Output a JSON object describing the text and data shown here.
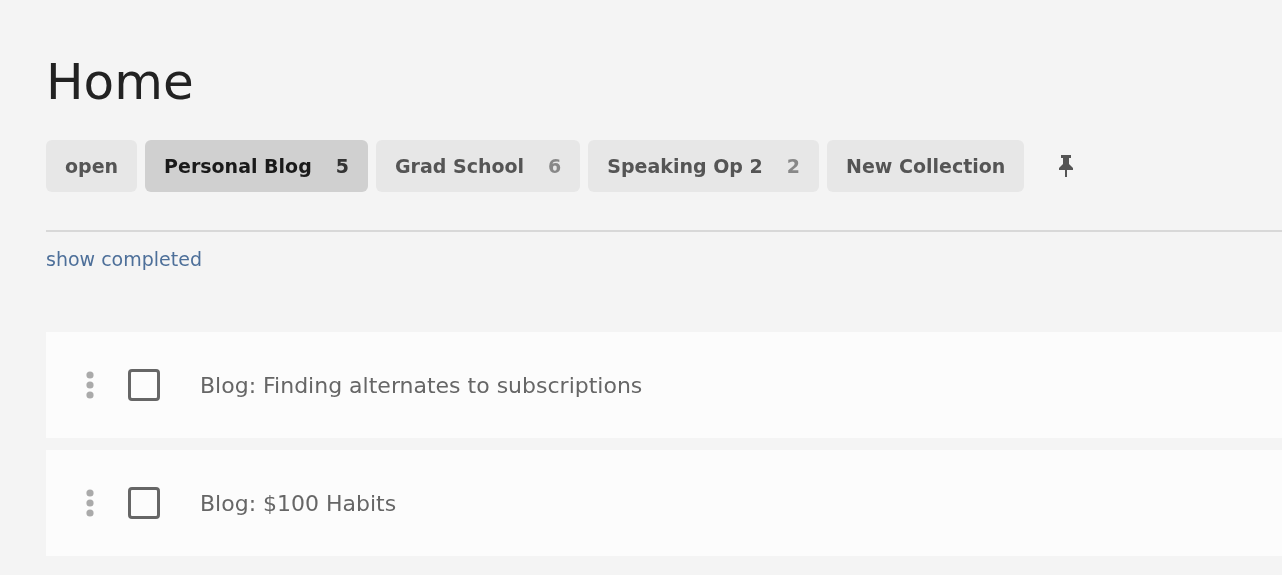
{
  "title": "Home",
  "tabs": [
    {
      "label": "open",
      "selected": false
    },
    {
      "label": "Personal Blog",
      "count": "5",
      "selected": true
    },
    {
      "label": "Grad School",
      "count": "6",
      "selected": false
    },
    {
      "label": "Speaking Op 2",
      "count": "2",
      "selected": false
    },
    {
      "label": "New Collection",
      "selected": false
    }
  ],
  "show_completed_link": "show completed",
  "tasks": [
    {
      "text": "Blog: Finding alternates to subscriptions",
      "checked": false
    },
    {
      "text": "Blog: $100 Habits",
      "checked": false
    }
  ]
}
